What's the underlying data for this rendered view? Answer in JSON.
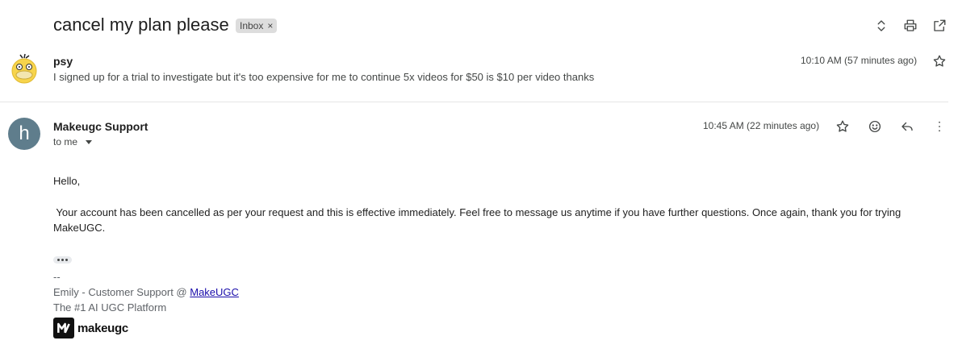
{
  "thread": {
    "subject": "cancel my plan please",
    "label": "Inbox",
    "label_remove": "×"
  },
  "toolbar_icons": [
    "expand-collapse-icon",
    "print-icon",
    "open-new-window-icon"
  ],
  "message1": {
    "sender": "psy",
    "snippet": "I signed up for a trial to investigate but it's too expensive for me to continue 5x videos for $50 is $10 per video thanks",
    "time": "10:10 AM (57 minutes ago)"
  },
  "message2": {
    "avatar_letter": "h",
    "avatar_color": "#5f7d8c",
    "sender": "Makeugc Support",
    "recipient": "to me",
    "time": "10:45 AM (22 minutes ago)",
    "greeting": "Hello,",
    "paragraph_line1": " Your account has been cancelled as per your request and this is effective immediately. Feel free to message us anytime if you have further questions. Once again, thank you for trying",
    "paragraph_line2": "MakeUGC.",
    "sig_dashes": "--",
    "sig_name": "Emily - Customer Support @ ",
    "sig_link": "MakeUGC",
    "sig_tagline": "The #1 AI UGC Platform",
    "logo_text": "makeugc"
  }
}
